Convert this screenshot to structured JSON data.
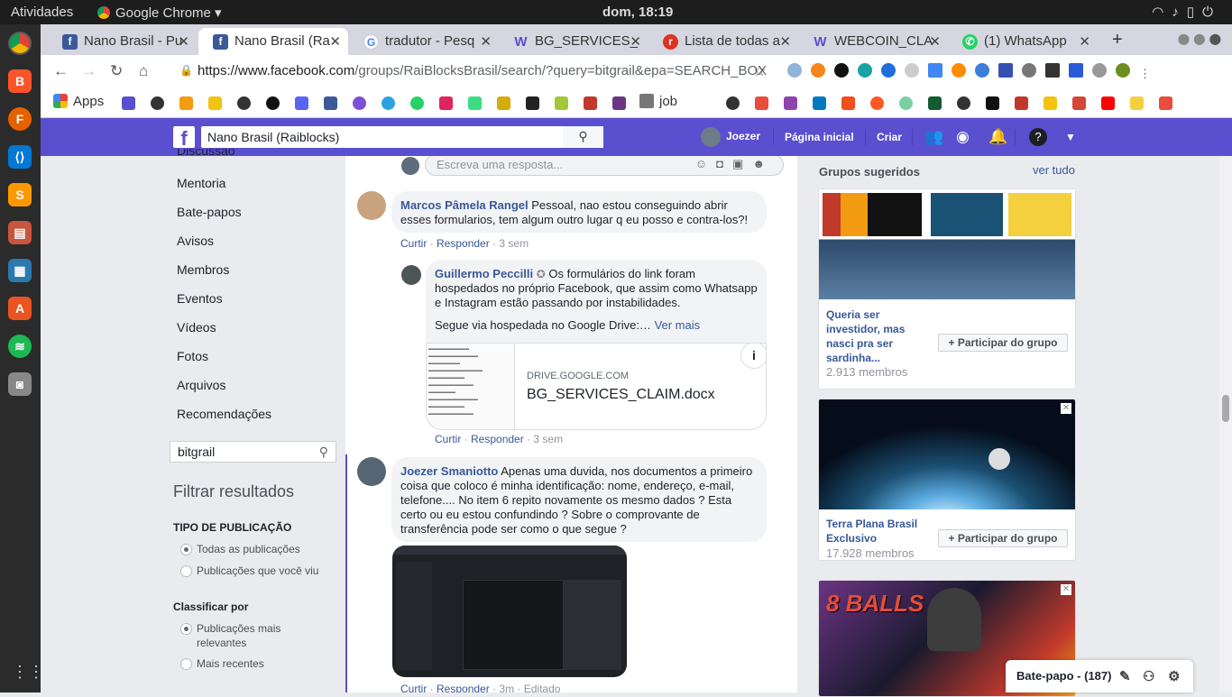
{
  "os": {
    "activities": "Atividades",
    "app_name": "Google Chrome ▾",
    "clock": "dom, 18:19"
  },
  "browser": {
    "tabs": [
      {
        "label": "Nano Brasil - Pu",
        "icon_color": "#3b5998",
        "icon": "f"
      },
      {
        "label": "Nano Brasil (Ra",
        "icon_color": "#3b5998",
        "icon": "f"
      },
      {
        "label": "tradutor - Pesq",
        "icon_color": "#ffffff",
        "icon": "G"
      },
      {
        "label": "BG_SERVICES_",
        "icon_color": "#6a5acd",
        "icon": "W"
      },
      {
        "label": "Lista de todas a",
        "icon_color": "#e0331f",
        "icon": "r"
      },
      {
        "label": "WEBCOIN_CLA",
        "icon_color": "#6a5acd",
        "icon": "W"
      },
      {
        "label": "(1) WhatsApp",
        "icon_color": "#25d366",
        "icon": "w"
      }
    ],
    "url_host": "https://www.facebook.com",
    "url_path": "/groups/RaiBlocksBrasil/search/?query=bitgrail&epa=SEARCH_BOX",
    "bookmarks": {
      "apps": "Apps",
      "job": "job"
    }
  },
  "facebook": {
    "search_value": "Nano Brasil (Raiblocks)",
    "user_name": "Joezer",
    "home": "Página inicial",
    "create": "Criar",
    "accent": "#5a4fcf"
  },
  "left_nav": {
    "partial": "Discussão",
    "items": [
      "Mentoria",
      "Bate-papos",
      "Avisos",
      "Membros",
      "Eventos",
      "Vídeos",
      "Fotos",
      "Arquivos",
      "Recomendações"
    ],
    "group_search": "bitgrail",
    "filter_title": "Filtrar resultados",
    "pub_type_title": "TIPO DE PUBLICAÇÃO",
    "pub_all": "Todas as publicações",
    "pub_seen": "Publicações que você viu",
    "sort_title": "Classificar por",
    "sort_relevant": "Publicações mais relevantes",
    "sort_recent": "Mais recentes"
  },
  "feed": {
    "reply_placeholder": "Escreva uma resposta...",
    "comment1": {
      "author": "Marcos Pâmela Rangel",
      "text": "Pessoal, nao estou conseguindo abrir esses formularios, tem algum outro lugar q eu posso e contra-los?!",
      "like": "Curtir",
      "reply": "Responder",
      "time": "3 sem"
    },
    "comment2": {
      "author": "Guillermo Peccilli",
      "text1": "Os formulários do link foram hospedados no próprio Facebook, que assim como Whatsapp e Instagram estão passando por instabilidades.",
      "text2": "Segue via hospedada no Google Drive:…",
      "more": "Ver mais",
      "link_domain": "DRIVE.GOOGLE.COM",
      "link_title": "BG_SERVICES_CLAIM.docx",
      "like": "Curtir",
      "reply": "Responder",
      "time": "3 sem"
    },
    "comment3": {
      "author": "Joezer Smaniotto",
      "text": "Apenas uma duvida, nos documentos a primeiro coisa que coloco é minha identificação: nome, endereço, e-mail, telefone.... No item 6 repito novamente os mesmo dados ? Esta certo ou eu estou confundindo ? Sobre o comprovante de transferência pode ser como o que segue ?",
      "like": "Curtir",
      "reply": "Responder",
      "time": "3m",
      "edited": "Editado"
    }
  },
  "suggested": {
    "title": "Grupos sugeridos",
    "see_all": "ver tudo",
    "join": "Participar do grupo",
    "groups": [
      {
        "name": "Queria ser investidor, mas nasci pra ser sardinha...",
        "members": "2.913 membros"
      },
      {
        "name": "Terra Plana Brasil Exclusivo",
        "members": "17.928 membros"
      }
    ],
    "ad_text": "8 BALLS"
  },
  "chat": {
    "label": "Bate-papo - (187)"
  }
}
